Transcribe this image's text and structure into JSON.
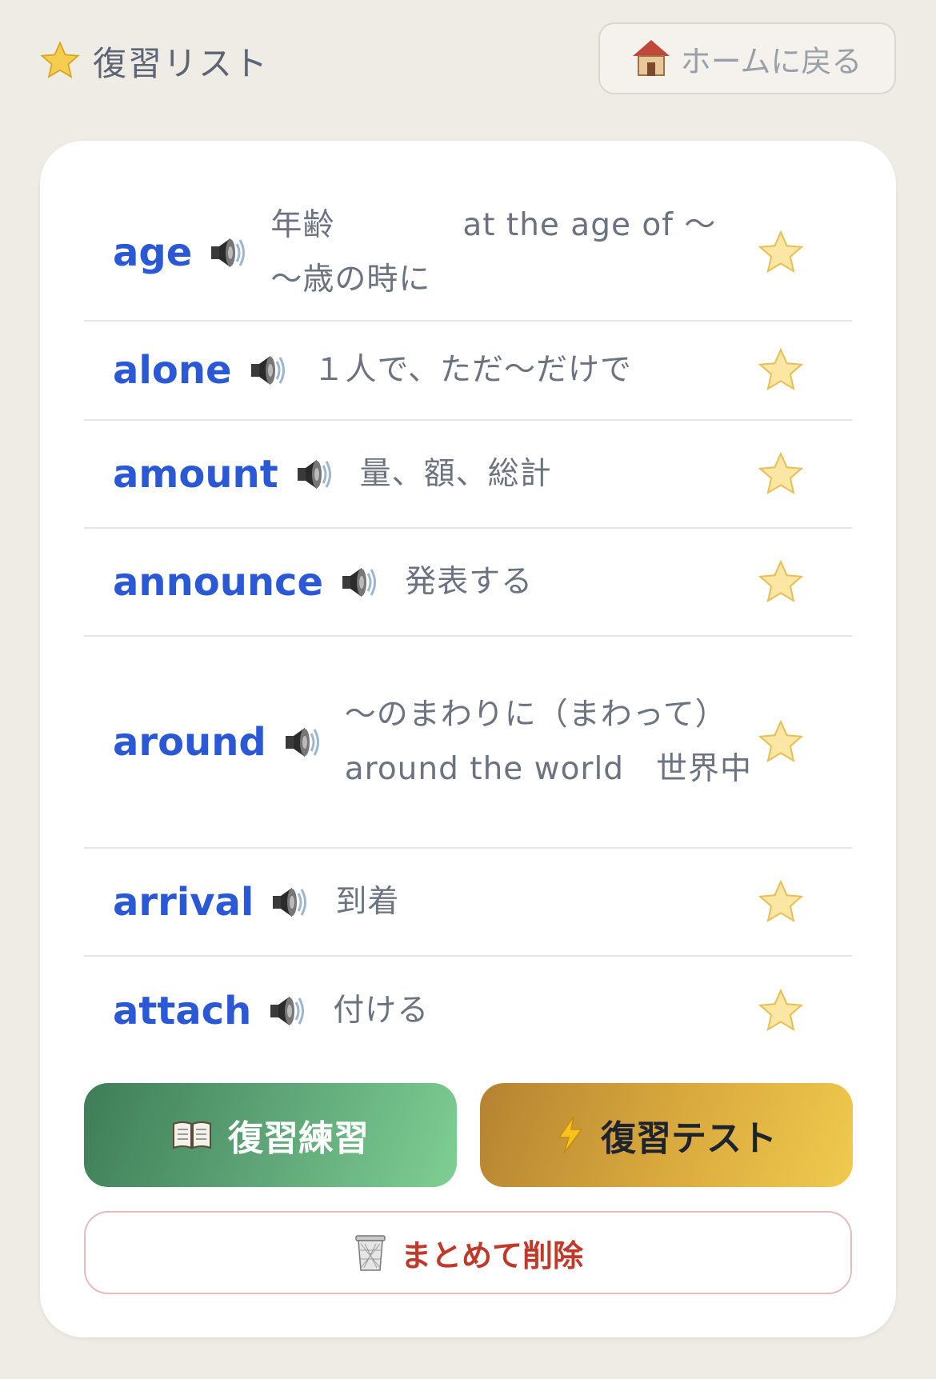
{
  "header": {
    "title": "復習リスト",
    "home_label": "ホームに戻る"
  },
  "items": [
    {
      "word": "age",
      "meaning": "年齢　　　　at the age of 〜 〜歳の時に"
    },
    {
      "word": "alone",
      "meaning": "１人で、ただ〜だけで"
    },
    {
      "word": "amount",
      "meaning": "量、額、総計"
    },
    {
      "word": "announce",
      "meaning": "発表する"
    },
    {
      "word": "around",
      "meaning": "〜のまわりに（まわって）　around the world　世界中"
    },
    {
      "word": "arrival",
      "meaning": "到着"
    },
    {
      "word": "attach",
      "meaning": "付ける"
    }
  ],
  "actions": {
    "practice_label": "復習練習",
    "test_label": "復習テスト",
    "delete_label": "まとめて削除"
  },
  "colors": {
    "word": "#2b59d6",
    "practice_start": "#3e7d57",
    "practice_end": "#7fcf94",
    "test_start": "#b58331",
    "test_end": "#f0ca4e",
    "delete_text": "#c0392b"
  },
  "icons": {
    "title": "star-icon",
    "home": "house-icon",
    "pronounce": "speaker-icon",
    "favorite": "star-icon",
    "practice": "open-book-icon",
    "test": "lightning-icon",
    "delete": "trash-can-icon"
  }
}
